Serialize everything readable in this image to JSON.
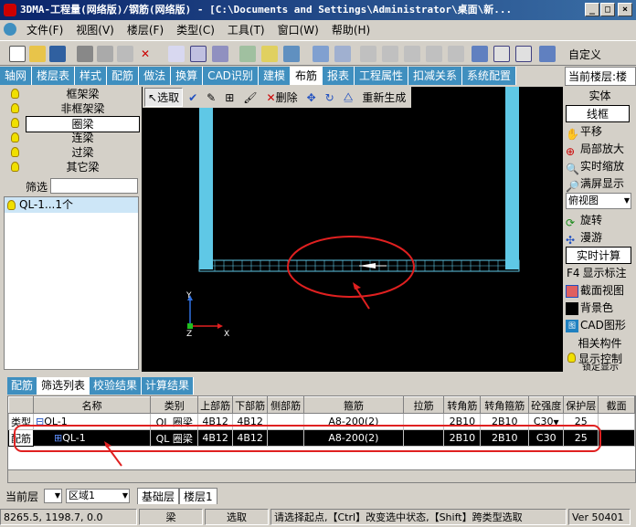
{
  "window": {
    "title": "3DMA-工程量(网络版)/钢筋(网络版) - [C:\\Documents and Settings\\Administrator\\桌面\\新..."
  },
  "menu": [
    "文件(F)",
    "视图(V)",
    "楼层(F)",
    "类型(C)",
    "工具(T)",
    "窗口(W)",
    "帮助(H)"
  ],
  "toolbar": {
    "custom_label": "自定义"
  },
  "main_tabs": [
    "轴网",
    "楼层表",
    "样式",
    "配筋",
    "做法",
    "换算",
    "CAD识别",
    "建模",
    "布筋",
    "报表",
    "工程属性",
    "扣减关系",
    "系统配置"
  ],
  "main_tabs_active": "布筋",
  "current_floor_label": "当前楼层:楼",
  "left_panel": {
    "categories": [
      "框架梁",
      "非框架梁",
      "圈梁",
      "连梁",
      "过梁",
      "其它梁"
    ],
    "selected": "圈梁",
    "filter_label": "筛选",
    "filter_items": [
      "QL-1...1个"
    ]
  },
  "canvas_toolbar": {
    "select_label": "选取",
    "delete_label": "删除",
    "regenerate_label": "重新生成"
  },
  "axes": {
    "y": "Y",
    "z": "Z",
    "x": "X"
  },
  "right_panel": {
    "solid": "实体",
    "wireframe": "线框",
    "pan": "平移",
    "zoom_local": "局部放大",
    "zoom_realtime": "实时缩放",
    "fit_screen": "满屏显示",
    "view_select": "俯视图",
    "rotate": "旋转",
    "roam": "漫游",
    "realtime_calc": "实时计算",
    "f4_label": "F4",
    "show_label": "显示标注",
    "section_view": "截面视图",
    "background_color": "背景色",
    "cad_graphic": "CAD图形",
    "related": "相关构件",
    "display_control": "显示控制",
    "lock_member": "锁定显示"
  },
  "bottom_tabs": [
    "配筋",
    "筛选列表",
    "校验结果",
    "计算结果"
  ],
  "bottom_tabs_active": "筛选列表",
  "grid": {
    "headers": [
      "",
      "名称",
      "类别",
      "上部筋",
      "下部筋",
      "侧部筋",
      "箍筋",
      "拉筋",
      "转角筋",
      "转角箍筋",
      "砼强度",
      "保护层",
      "截面"
    ],
    "rows": [
      {
        "label": "类型",
        "name": "QL-1",
        "category": "QL 圈梁",
        "top": "4B12",
        "bottom": "4B12",
        "side": "",
        "stirrup": "A8-200(2)",
        "tie": "",
        "corner": "2B10",
        "corner_stirrup": "2B10",
        "concrete": "C30",
        "cover": "25",
        "section": ""
      },
      {
        "label": "配筋",
        "name": "QL-1",
        "category": "QL 圈梁",
        "top": "4B12",
        "bottom": "4B12",
        "side": "",
        "stirrup": "A8-200(2)",
        "tie": "",
        "corner": "2B10",
        "corner_stirrup": "2B10",
        "concrete": "C30",
        "cover": "25",
        "section": ""
      }
    ]
  },
  "floor_bar": {
    "current_label": "当前层",
    "region": "区域1",
    "tabs": [
      "基础层",
      "楼层1"
    ]
  },
  "status": {
    "coords": "8265.5, 1198.7, 0.0",
    "type": "梁",
    "mode": "选取",
    "hint": "请选择起点,【Ctrl】改变选中状态,【Shift】跨类型选取",
    "version": "Ver 50401"
  }
}
